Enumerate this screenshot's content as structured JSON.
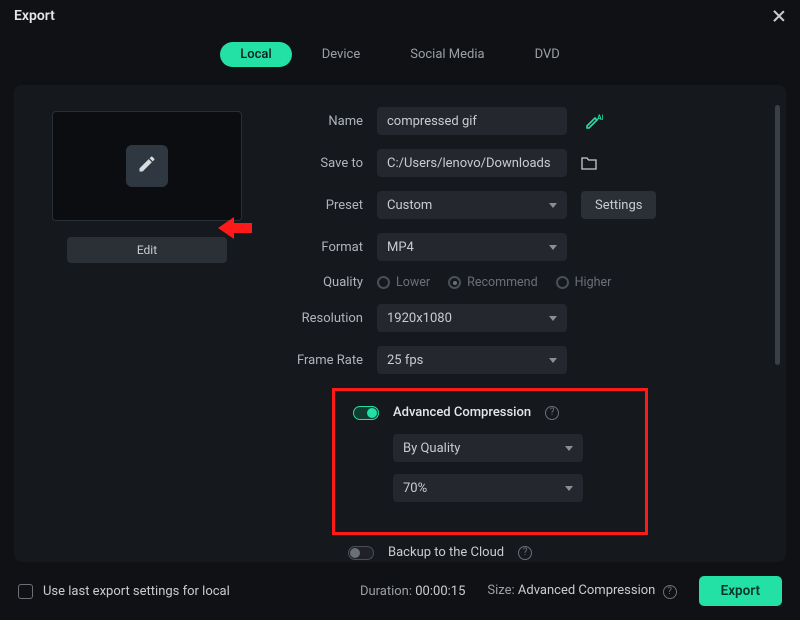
{
  "window": {
    "title": "Export"
  },
  "tabs": {
    "local": "Local",
    "device": "Device",
    "social": "Social Media",
    "dvd": "DVD"
  },
  "preview": {
    "edit_btn": "Edit"
  },
  "fields": {
    "name_label": "Name",
    "name_value": "compressed gif",
    "saveto_label": "Save to",
    "saveto_value": "C:/Users/lenovo/Downloads",
    "preset_label": "Preset",
    "preset_value": "Custom",
    "settings_btn": "Settings",
    "format_label": "Format",
    "format_value": "MP4",
    "quality_label": "Quality",
    "quality_lower": "Lower",
    "quality_recommend": "Recommend",
    "quality_higher": "Higher",
    "resolution_label": "Resolution",
    "resolution_value": "1920x1080",
    "framerate_label": "Frame Rate",
    "framerate_value": "25 fps"
  },
  "advanced": {
    "title": "Advanced Compression",
    "mode_value": "By Quality",
    "amount_value": "70%"
  },
  "backup": {
    "label": "Backup to the Cloud"
  },
  "footer": {
    "use_last": "Use last export settings for local",
    "duration_label": "Duration:",
    "duration_value": "00:00:15",
    "size_label": "Size:",
    "size_value": "Advanced Compression",
    "export_btn": "Export"
  },
  "icons": {
    "close": "close-icon",
    "pencil": "pencil-icon",
    "ai": "ai-pen-icon",
    "folder": "folder-icon",
    "chevron": "chevron-down-icon",
    "arrow": "red-arrow-icon",
    "help": "help-icon",
    "checkbox": "checkbox"
  }
}
